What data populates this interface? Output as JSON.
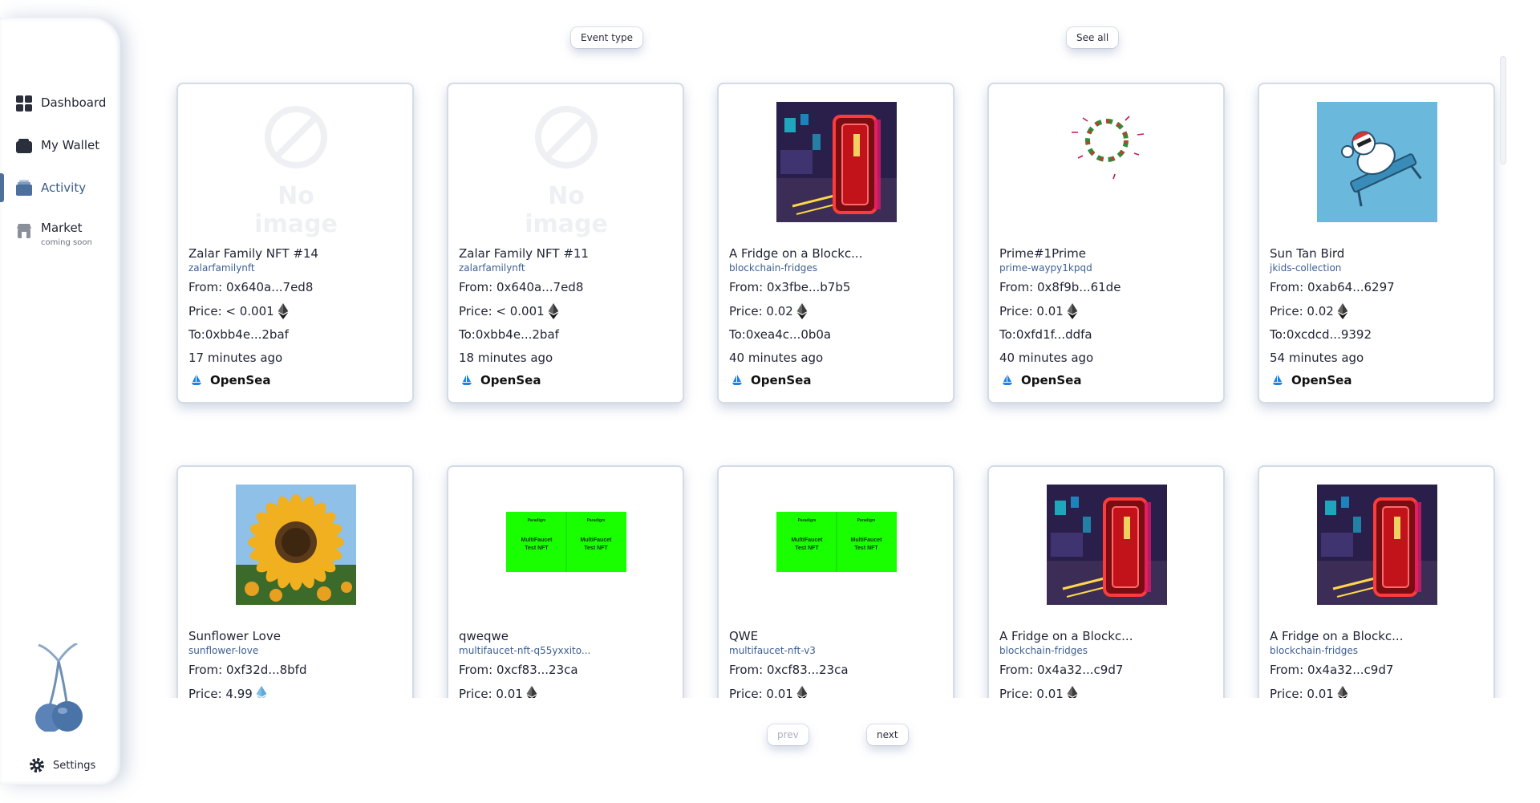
{
  "sidebar": {
    "items": [
      {
        "label": "Dashboard",
        "icon": "dashboard-icon"
      },
      {
        "label": "My Wallet",
        "icon": "wallet-icon"
      },
      {
        "label": "Activity",
        "icon": "activity-icon"
      },
      {
        "label": "Market",
        "icon": "market-icon",
        "sublabel": "coming soon"
      }
    ],
    "settings_label": "Settings",
    "active_color": "#4c6f9c"
  },
  "filters": {
    "event_type_label": "Event type",
    "see_all_label": "See all"
  },
  "pagination": {
    "prev_label": "prev",
    "next_label": "next"
  },
  "no_image_text": "No image",
  "cards": [
    {
      "title": "Zalar Family NFT #14",
      "collection": "zalarfamilynft",
      "from": "From: 0x640a...7ed8",
      "price": "Price: < 0.001",
      "to": "To:0xbb4e...2baf",
      "time": "17 minutes ago",
      "market": "OpenSea",
      "image": "no-image"
    },
    {
      "title": "Zalar Family NFT #11",
      "collection": "zalarfamilynft",
      "from": "From: 0x640a...7ed8",
      "price": "Price: < 0.001",
      "to": "To:0xbb4e...2baf",
      "time": "18 minutes ago",
      "market": "OpenSea",
      "image": "no-image"
    },
    {
      "title": "A Fridge on a Blockc...",
      "collection": "blockchain-fridges",
      "from": "From: 0x3fbe...b7b5",
      "price": "Price: 0.02",
      "to": "To:0xea4c...0b0a",
      "time": "40 minutes ago",
      "market": "OpenSea",
      "image": "fridge"
    },
    {
      "title": "Prime#1Prime",
      "collection": "prime-waypy1kpqd",
      "from": "From: 0x8f9b...61de",
      "price": "Price: 0.01",
      "to": "To:0xfd1f...ddfa",
      "time": "40 minutes ago",
      "market": "OpenSea",
      "image": "wreath"
    },
    {
      "title": "Sun Tan Bird",
      "collection": "jkids-collection",
      "from": "From: 0xab64...6297",
      "price": "Price: 0.02",
      "to": "To:0xcdcd...9392",
      "time": "54 minutes ago",
      "market": "OpenSea",
      "image": "bird"
    },
    {
      "title": "Sunflower Love",
      "collection": "sunflower-love",
      "from": "From: 0xf32d...8bfd",
      "price": "Price: 4.99",
      "to": "",
      "time": "",
      "market": "",
      "image": "sunflower",
      "currency": "blue"
    },
    {
      "title": "qweqwe",
      "collection": "multifaucet-nft-q55yxxito...",
      "from": "From: 0xcf83...23ca",
      "price": "Price: 0.01",
      "to": "",
      "time": "",
      "market": "",
      "image": "multifaucet"
    },
    {
      "title": "QWE",
      "collection": "multifaucet-nft-v3",
      "from": "From: 0xcf83...23ca",
      "price": "Price: 0.01",
      "to": "",
      "time": "",
      "market": "",
      "image": "multifaucet"
    },
    {
      "title": "A Fridge on a Blockc...",
      "collection": "blockchain-fridges",
      "from": "From: 0x4a32...c9d7",
      "price": "Price: 0.01",
      "to": "",
      "time": "",
      "market": "",
      "image": "fridge"
    },
    {
      "title": "A Fridge on a Blockc...",
      "collection": "blockchain-fridges",
      "from": "From: 0x4a32...c9d7",
      "price": "Price: 0.01",
      "to": "",
      "time": "",
      "market": "",
      "image": "fridge"
    }
  ],
  "multifaucet_text": {
    "brand": "Paradigm",
    "line1": "MultiFaucet",
    "line2": "Test NFT"
  }
}
